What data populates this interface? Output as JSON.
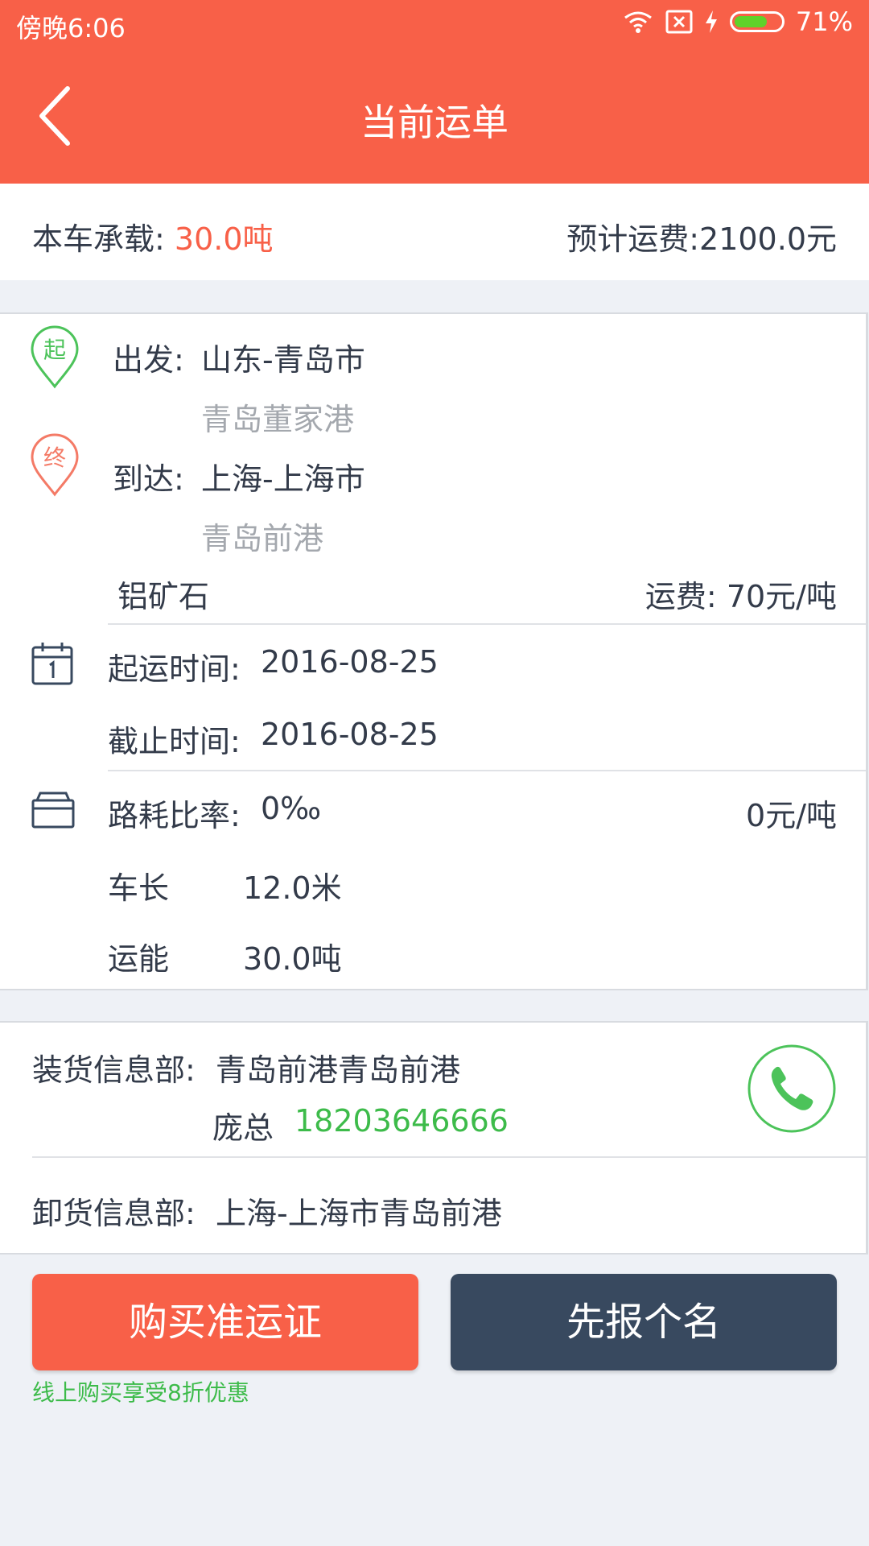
{
  "status_bar": {
    "time": "傍晚6:06",
    "battery": "71%",
    "battery_level": 0.71
  },
  "nav": {
    "title": "当前运单"
  },
  "summary": {
    "capacity_label": "本车承载:",
    "capacity_value": "30.0吨",
    "freight_label": "预计运费:",
    "freight_value": "2100.0元"
  },
  "route": {
    "start_marker": "起",
    "end_marker": "终",
    "depart_label": "出发:",
    "depart_city": "山东-青岛市",
    "depart_place": "青岛董家港",
    "arrive_label": "到达:",
    "arrive_city": "上海-上海市",
    "arrive_place": "青岛前港",
    "cargo": "铝矿石",
    "rate_label": "运费:",
    "rate_value": "70元/吨"
  },
  "schedule": {
    "start_label": "起运时间:",
    "start_value": "2016-08-25",
    "end_label": "截止时间:",
    "end_value": "2016-08-25"
  },
  "vehicle": {
    "loss_label": "路耗比率:",
    "loss_value": "0‰",
    "loss_price": "0元/吨",
    "length_label": "车长",
    "length_value": "12.0米",
    "capacity_label": "运能",
    "capacity_value": "30.0吨"
  },
  "contacts": {
    "loading_label": "装货信息部:",
    "loading_value": "青岛前港青岛前港",
    "contact_name": "庞总",
    "contact_phone": "18203646666",
    "unloading_label": "卸货信息部:",
    "unloading_value": "上海-上海市青岛前港"
  },
  "actions": {
    "buy_label": "购买准运证",
    "sign_label": "先报个名",
    "promo": "线上购买享受8折优惠"
  },
  "colors": {
    "accent": "#f86048",
    "dark_button": "#38495f",
    "green": "#3dbb4a"
  }
}
